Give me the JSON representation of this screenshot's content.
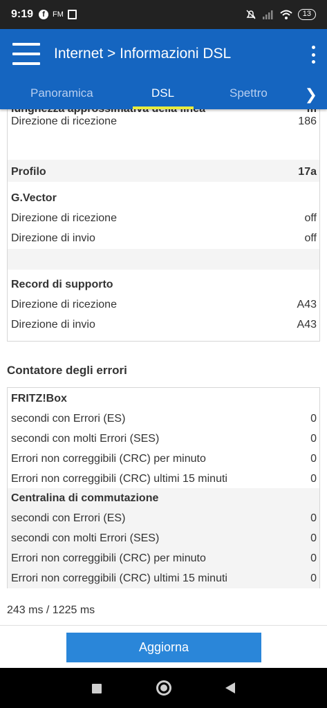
{
  "status_bar": {
    "time": "9:19",
    "fm": "FM",
    "battery": "13",
    "icons": [
      "facebook-icon",
      "twitch-icon",
      "mute-icon",
      "signal-icon",
      "wifi-icon",
      "battery-icon"
    ]
  },
  "app_bar": {
    "title": "Internet > Informazioni DSL",
    "tabs": [
      {
        "label": "Panoramica",
        "active": false
      },
      {
        "label": "DSL",
        "active": true
      },
      {
        "label": "Spettro",
        "active": false
      }
    ],
    "accent_color": "#1565c0",
    "tab_indicator_color": "#e9ec3c"
  },
  "dsl_table": {
    "cut_row_label": "lunghezza approssimativa della linea",
    "cut_row_value": "m",
    "rows": [
      {
        "label": "Direzione di ricezione",
        "value": "186"
      }
    ],
    "profilo": {
      "label": "Profilo",
      "value": "17a"
    },
    "gvector": {
      "title": "G.Vector",
      "rows": [
        {
          "label": "Direzione di ricezione",
          "value": "off"
        },
        {
          "label": "Direzione di invio",
          "value": "off"
        }
      ]
    },
    "record": {
      "title": "Record di supporto",
      "rows": [
        {
          "label": "Direzione di ricezione",
          "value": "A43"
        },
        {
          "label": "Direzione di invio",
          "value": "A43"
        }
      ]
    }
  },
  "errors": {
    "section_title": "Contatore degli errori",
    "fritzbox": {
      "title": "FRITZ!Box",
      "rows": [
        {
          "label": "secondi con Errori (ES)",
          "value": "0"
        },
        {
          "label": "secondi con molti Errori (SES)",
          "value": "0"
        },
        {
          "label": "Errori non correggibili (CRC) per minuto",
          "value": "0"
        },
        {
          "label": "Errori non correggibili (CRC) ultimi 15 minuti",
          "value": "0"
        }
      ]
    },
    "centralina": {
      "title": "Centralina di commutazione",
      "rows": [
        {
          "label": "secondi con Errori (ES)",
          "value": "0"
        },
        {
          "label": "secondi con molti Errori (SES)",
          "value": "0"
        },
        {
          "label": "Errori non correggibili (CRC) per minuto",
          "value": "0"
        },
        {
          "label": "Errori non correggibili (CRC) ultimi 15 minuti",
          "value": "0"
        }
      ]
    }
  },
  "timing": "243 ms / 1225 ms",
  "refresh_button": "Aggiorna"
}
